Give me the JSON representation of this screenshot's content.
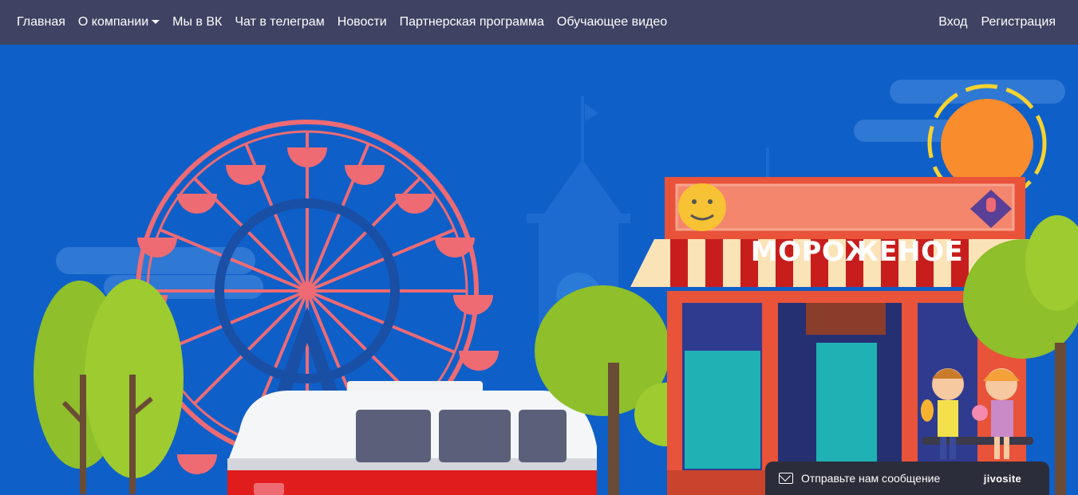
{
  "nav": {
    "items": [
      {
        "label": "Главная"
      },
      {
        "label": "О компании",
        "has_dropdown": true
      },
      {
        "label": "Мы в ВК"
      },
      {
        "label": "Чат в телеграм"
      },
      {
        "label": "Новости"
      },
      {
        "label": "Партнерская программа"
      },
      {
        "label": "Обучающее видео"
      }
    ],
    "login": "Вход",
    "register": "Регистрация"
  },
  "hero": {
    "shop_sign": "МОРОЖЕНОЕ"
  },
  "chat_widget": {
    "message": "Отправьте нам сообщение",
    "brand": "jivosite",
    "icon": "envelope-icon"
  },
  "colors": {
    "navbar": "#3f4262",
    "hero_bg": "#0f5fc8",
    "ferris_wheel": "#ee6b73",
    "shop_red": "#e8533a",
    "chat_bg": "#2b2d3a"
  }
}
